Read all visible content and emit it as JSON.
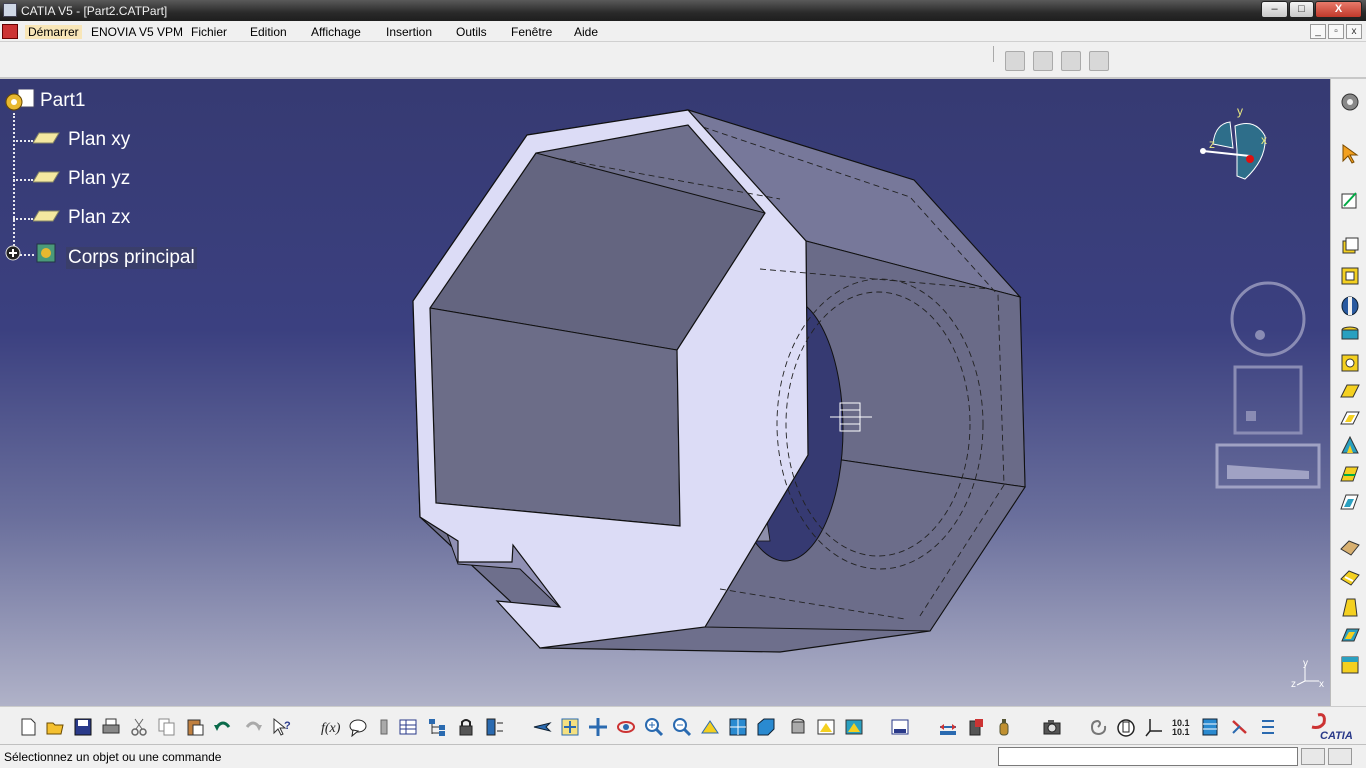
{
  "window": {
    "title": "CATIA V5 - [Part2.CATPart]",
    "minimize": "–",
    "maximize": "□",
    "close": "X"
  },
  "menu": {
    "items": [
      {
        "label": "Démarrer",
        "active": true
      },
      {
        "label": "ENOVIA V5 VPM"
      },
      {
        "label": "Fichier"
      },
      {
        "label": "Edition"
      },
      {
        "label": "Affichage"
      },
      {
        "label": "Insertion"
      },
      {
        "label": "Outils"
      },
      {
        "label": "Fenêtre"
      },
      {
        "label": "Aide"
      }
    ]
  },
  "tree": {
    "root": "Part1",
    "items": [
      {
        "label": "Plan xy",
        "icon": "plane-icon"
      },
      {
        "label": "Plan yz",
        "icon": "plane-icon"
      },
      {
        "label": "Plan zx",
        "icon": "plane-icon"
      },
      {
        "label": "Corps principal",
        "icon": "body-icon",
        "expandable": true
      }
    ]
  },
  "compass": {
    "x": "x",
    "y": "y",
    "z": "z"
  },
  "axis_triad": {
    "x": "x",
    "y": "y",
    "z": "z"
  },
  "status": {
    "message": "Sélectionnez un objet ou une commande",
    "command_input": ""
  },
  "logo": "CATIA",
  "colors": {
    "viewport_top": "#363a72",
    "viewport_bottom": "#b0b2c8",
    "part_face": "#6c6d8a",
    "part_edge_face": "#d8d8f4",
    "accent": "#c33"
  }
}
